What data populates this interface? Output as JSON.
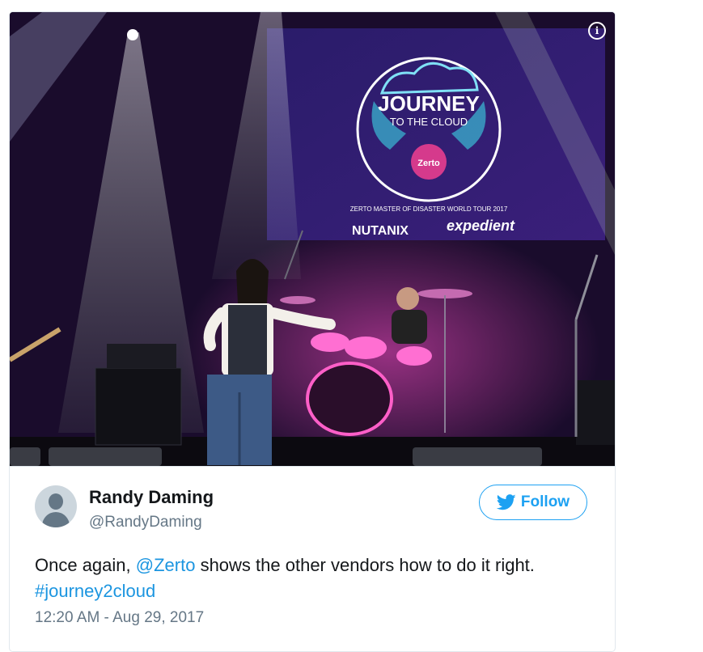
{
  "author": {
    "name": "Randy Daming",
    "handle": "@RandyDaming"
  },
  "follow_button": {
    "label": "Follow",
    "icon": "twitter-bird-icon"
  },
  "tweet": {
    "text_before": "Once again,",
    "mention": "@Zerto",
    "text_after": " shows the other vendors how to do it right.",
    "hashtag": "#journey2cloud"
  },
  "timestamp": "12:20 AM - Aug 29, 2017",
  "photo": {
    "banner": {
      "title": "JOURNEY",
      "subtitle": "TO THE CLOUD",
      "badge": "Zerto",
      "tour_text": "ZERTO MASTER OF DISASTER WORLD TOUR 2017",
      "sponsor_1": "NUTANIX",
      "sponsor_2": "expedient"
    },
    "info_icon": "info-icon"
  },
  "colors": {
    "accent": "#1da1f2",
    "link": "#1b95e0",
    "text": "#14171a",
    "secondary": "#657786",
    "border": "#e1e8ed"
  }
}
